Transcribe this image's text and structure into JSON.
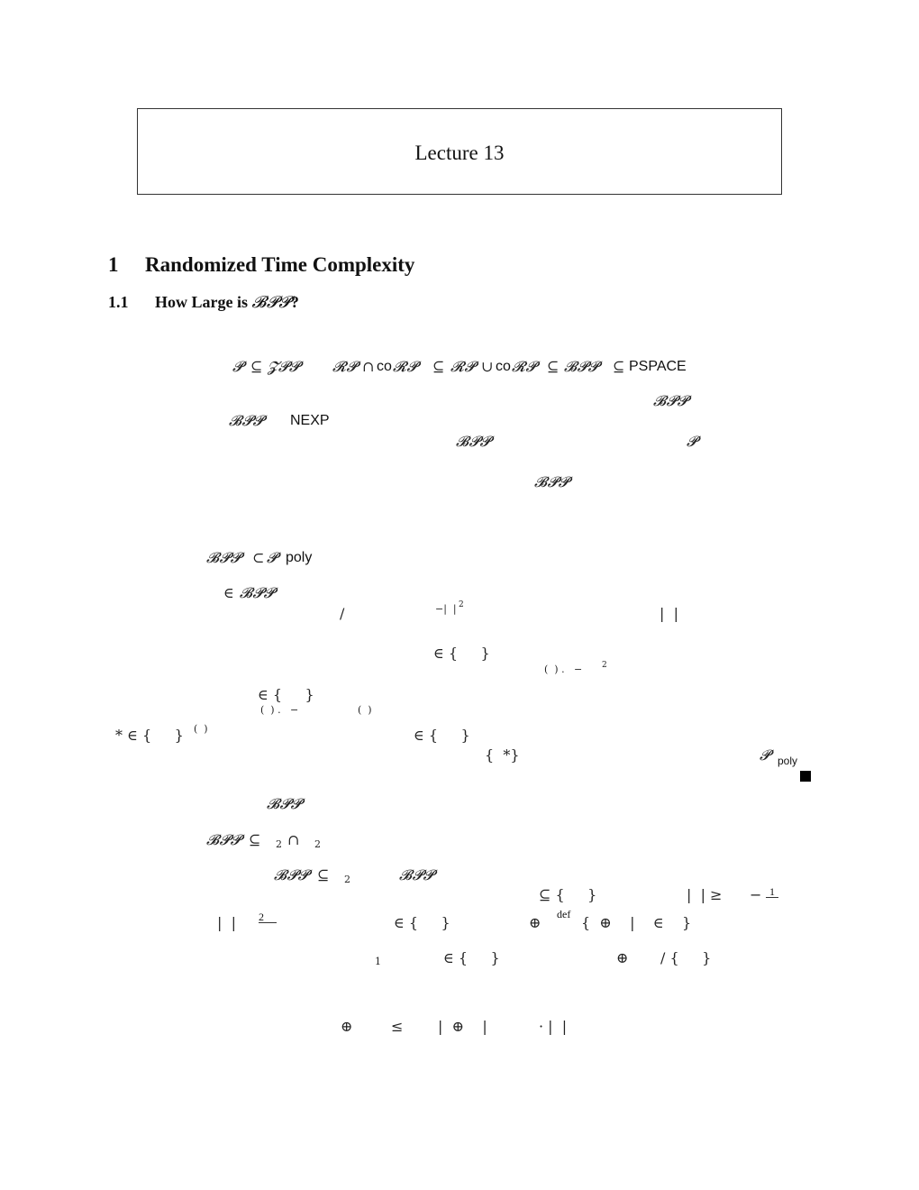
{
  "header": {
    "title": "Lecture 13"
  },
  "section": {
    "number": "1",
    "title": "Randomized Time Complexity"
  },
  "subsection": {
    "number": "1.1",
    "title_prefix": "How Large is ",
    "title_class": "𝓑𝓟𝓟",
    "title_suffix": "?"
  },
  "fragments": {
    "chain": {
      "p": "𝓟",
      "subseteq1": "⊆",
      "zpp": "𝓩𝓟𝓟",
      "rp1": "𝓡𝓟",
      "cap": "∩",
      "co1": "co",
      "corp1": "𝓡𝓟",
      "subseteq2": "⊆",
      "rp2": "𝓡𝓟",
      "cup": "∪",
      "co2": "co",
      "corp2": "𝓡𝓟",
      "subseteq3": "⊆",
      "bpp": "𝓑𝓟𝓟",
      "subseteq4": "⊆",
      "pspace": "PSPACE"
    },
    "para1": {
      "bpp_a": "𝓑𝓟𝓟",
      "bpp_b": "𝓑𝓟𝓟",
      "nexp": "NEXP",
      "bpp_c": "𝓑𝓟𝓟",
      "p": "𝓟",
      "bpp_d": "𝓑𝓟𝓟"
    },
    "theorem1": {
      "bpp": "𝓑𝓟𝓟",
      "subset": "⊂",
      "p": "𝓟",
      "poly": "poly"
    },
    "proof1": {
      "in_bpp": "∈ 𝓑𝓟𝓟",
      "slash": "/",
      "neg_abs": "−|  |",
      "sup2": "2",
      "abs_bars": "|  |",
      "in_set_a": "∈ {     }",
      "prob_a": "(  ) .   −",
      "sup2_b": "2",
      "in_set_b": "∈ {     }",
      "prob_b": "(  ) .   −",
      "paren_b": "(  )",
      "star_in": "* ∈ {     }",
      "sup_paren": "(  )",
      "in_set_c": "∈ {     }",
      "set_star": "{  *}",
      "p_poly_p": "𝓟",
      "p_poly_sub": "poly"
    },
    "para2": {
      "bpp": "𝓑𝓟𝓟"
    },
    "theorem2": {
      "bpp": "𝓑𝓟𝓟",
      "subseteq": "⊆",
      "sub2a": "2",
      "cap": "∩",
      "sub2b": "2"
    },
    "proof2": {
      "bpp": "𝓑𝓟𝓟",
      "subseteq": "⊆",
      "sub2": "2",
      "bpp_b": "𝓑𝓟𝓟",
      "subset_set": "⊆ {     }",
      "abs_geq": "|  | ≥",
      "minus": "−",
      "frac1_num": "1",
      "abs_bars": "|  |",
      "frac2_num": "2",
      "in_set": "∈ {     }",
      "oplus": "⊕",
      "def": "def",
      "set_def": "{  ⊕    |    ∈    }",
      "sub1": "1",
      "in_set_b": "∈ {     }",
      "oplus_b": "⊕",
      "quot_set": "/ {     }",
      "ineq_oplus": "⊕",
      "ineq_leq": "≤",
      "ineq_abs": "|  ⊕    |",
      "ineq_dot": "· |  |"
    }
  }
}
